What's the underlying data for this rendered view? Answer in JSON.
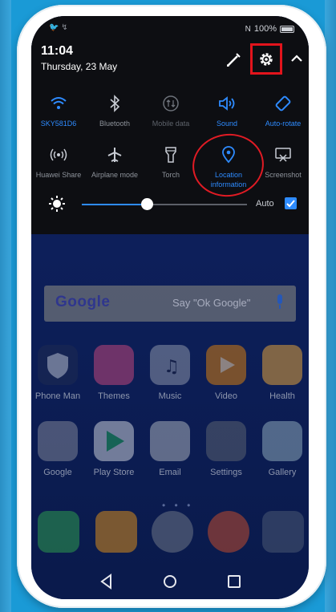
{
  "status": {
    "carrier": "🐦 ↯",
    "battery": "100%"
  },
  "shade": {
    "time": "11:04",
    "date": "Thursday, 23 May",
    "tiles_row1": [
      {
        "label": "SKY581D6",
        "icon": "wifi-icon",
        "state": "on"
      },
      {
        "label": "Bluetooth",
        "icon": "bluetooth-icon",
        "state": "off"
      },
      {
        "label": "Mobile data",
        "icon": "mobile-data-icon",
        "state": "dim"
      },
      {
        "label": "Sound",
        "icon": "sound-icon",
        "state": "on"
      },
      {
        "label": "Auto-rotate",
        "icon": "auto-rotate-icon",
        "state": "on"
      }
    ],
    "tiles_row2": [
      {
        "label": "Huawei Share",
        "icon": "huawei-share-icon",
        "state": "off"
      },
      {
        "label": "Airplane mode",
        "icon": "airplane-icon",
        "state": "off"
      },
      {
        "label": "Torch",
        "icon": "torch-icon",
        "state": "off"
      },
      {
        "label": "Location information",
        "icon": "location-icon",
        "state": "on"
      },
      {
        "label": "Screenshot",
        "icon": "screenshot-icon",
        "state": "off"
      }
    ],
    "brightness": {
      "level": 0.36,
      "auto_label": "Auto",
      "auto_checked": true
    }
  },
  "home": {
    "search": {
      "logo": "Google",
      "hint": "Say \"Ok Google\""
    },
    "row1": [
      "Phone Man",
      "Themes",
      "Music",
      "Video",
      "Health"
    ],
    "row2": [
      "Google",
      "Play Store",
      "Email",
      "Settings",
      "Gallery"
    ],
    "page_dots": "• • •"
  },
  "colors": {
    "accent": "#2e8bff",
    "highlight": "#e2141c",
    "background": "#1a9ad6"
  }
}
